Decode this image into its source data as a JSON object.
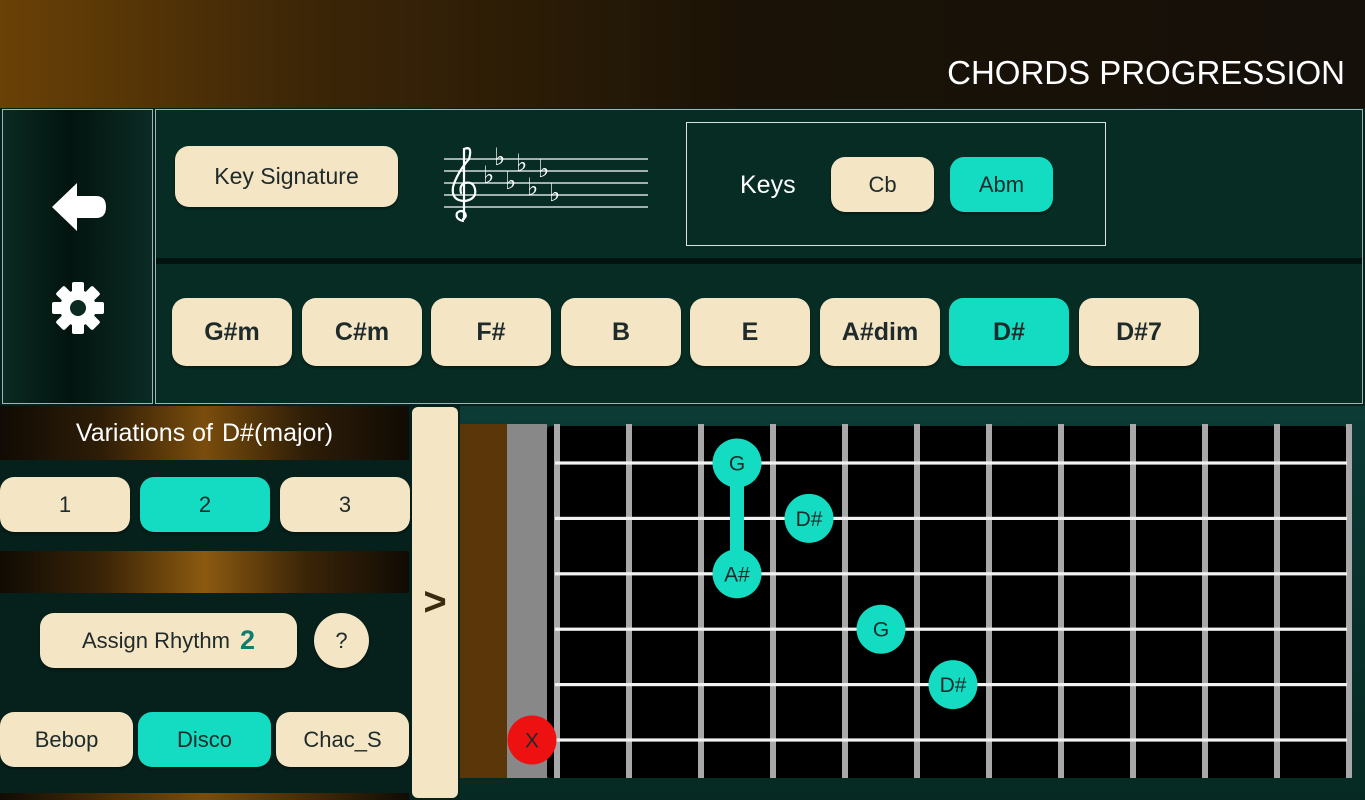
{
  "header": {
    "title": "CHORDS PROGRESSION"
  },
  "sidebar": {
    "back_icon": "arrow-left-icon",
    "settings_icon": "gear-icon"
  },
  "key_section": {
    "key_signature_label": "Key Signature",
    "keys_label": "Keys",
    "keys": [
      {
        "label": "Cb",
        "active": false
      },
      {
        "label": "Abm",
        "active": true
      }
    ]
  },
  "chords": [
    {
      "label": "G#m",
      "active": false
    },
    {
      "label": "C#m",
      "active": false
    },
    {
      "label": "F#",
      "active": false
    },
    {
      "label": "B",
      "active": false
    },
    {
      "label": "E",
      "active": false
    },
    {
      "label": "A#dim",
      "active": false
    },
    {
      "label": "D#",
      "active": true
    },
    {
      "label": "D#7",
      "active": false
    }
  ],
  "variations": {
    "title": "Variations of",
    "chord": "D#(major)",
    "options": [
      {
        "label": "1",
        "active": false
      },
      {
        "label": "2",
        "active": true
      },
      {
        "label": "3",
        "active": false
      }
    ]
  },
  "rhythm": {
    "assign_label": "Assign Rhythm",
    "assign_value": "2",
    "help_label": "?",
    "styles": [
      {
        "label": "Bebop",
        "active": false
      },
      {
        "label": "Disco",
        "active": true
      },
      {
        "label": "Chac_S",
        "active": false
      }
    ]
  },
  "next_label": ">",
  "fretboard": {
    "muted_label": "X",
    "notes": [
      {
        "label": "G",
        "string": 1,
        "fret": 3
      },
      {
        "label": "D#",
        "string": 2,
        "fret": 4
      },
      {
        "label": "A#",
        "string": 3,
        "fret": 3
      },
      {
        "label": "G",
        "string": 4,
        "fret": 5
      },
      {
        "label": "D#",
        "string": 5,
        "fret": 6
      }
    ],
    "muted_string": 6,
    "barre": {
      "fret": 3,
      "from_string": 1,
      "to_string": 3
    },
    "colors": {
      "note": "#13dcc2",
      "muted": "#ee1111",
      "nut": "#888888",
      "headstock": "#5a3608"
    }
  }
}
